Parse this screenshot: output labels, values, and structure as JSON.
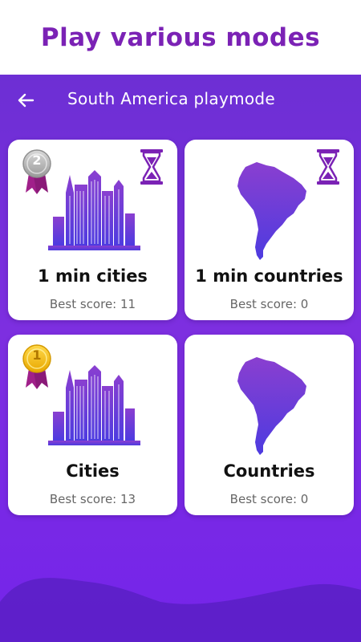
{
  "promo": {
    "heading": "Play various modes"
  },
  "header": {
    "title": "South America playmode",
    "back_icon": "arrow-left-icon"
  },
  "modes": [
    {
      "name": "1 min cities",
      "score_text": "Best score: 11",
      "medal": "silver",
      "medal_number": "2",
      "timed": true,
      "illustration": "city-skyline-icon"
    },
    {
      "name": "1 min countries",
      "score_text": "Best score: 0",
      "medal": null,
      "timed": true,
      "illustration": "south-america-map-icon"
    },
    {
      "name": "Cities",
      "score_text": "Best score: 13",
      "medal": "gold",
      "medal_number": "1",
      "timed": false,
      "illustration": "city-skyline-icon"
    },
    {
      "name": "Countries",
      "score_text": "Best score: 0",
      "medal": null,
      "timed": false,
      "illustration": "south-america-map-icon"
    }
  ],
  "colors": {
    "accent": "#7b22b5",
    "background": "#7a2fe0",
    "illustration": "#6633cc"
  }
}
